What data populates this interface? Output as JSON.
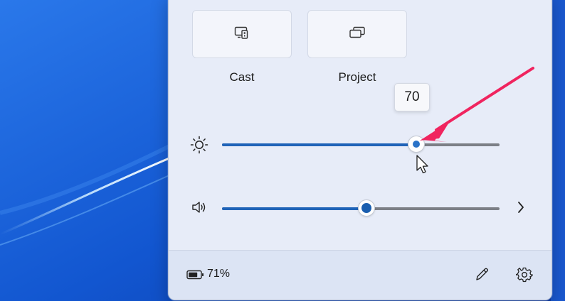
{
  "quick_settings": {
    "tiles": [
      {
        "label": "Cast",
        "icon": "cast-icon"
      },
      {
        "label": "Project",
        "icon": "project-icon"
      }
    ],
    "brightness": {
      "icon": "sun-icon",
      "value": 70,
      "tooltip": "70"
    },
    "volume": {
      "icon": "speaker-icon",
      "value": 52,
      "expand_icon": "chevron-right-icon"
    },
    "footer": {
      "battery_icon": "battery-icon",
      "battery_text": "71%",
      "edit_icon": "pencil-icon",
      "settings_icon": "gear-icon"
    }
  },
  "colors": {
    "accent": "#1f63b8",
    "annotation_arrow": "#f0245f",
    "panel_background": "#e7ecf8",
    "wallpaper": "#1f5fd6"
  }
}
